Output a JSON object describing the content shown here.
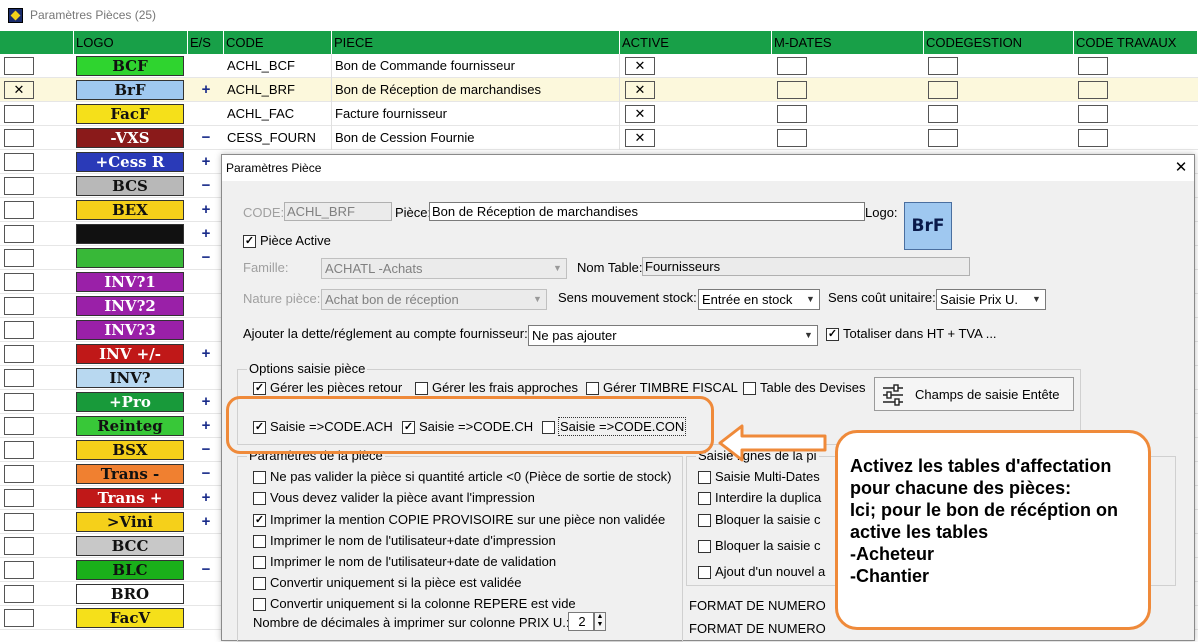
{
  "window": {
    "title": "Paramètres Pièces (25)"
  },
  "grid": {
    "headers": [
      "",
      "LOGO",
      "E/S",
      "CODE",
      "PIECE",
      "ACTIVE",
      "M-DATES",
      "CODEGESTION",
      "CODE TRAVAUX"
    ],
    "rows": [
      {
        "code": "ACHL_BCF",
        "piece": "Bon de Commande fournisseur",
        "active": "✕",
        "sel": "",
        "es": ""
      },
      {
        "code": "ACHL_BRF",
        "piece": "Bon de Réception de marchandises",
        "active": "✕",
        "sel": "✕",
        "es": "+"
      },
      {
        "code": "ACHL_FAC",
        "piece": "Facture fournisseur",
        "active": "✕",
        "sel": "",
        "es": ""
      },
      {
        "code": "CESS_FOURN",
        "piece": "Bon de Cession Fournie",
        "active": "✕",
        "sel": "",
        "es": "−"
      }
    ],
    "logos": [
      "BCF",
      "BrF",
      "FacF",
      "-VXS",
      "+Cess R",
      "BCS",
      "BEX",
      "",
      "",
      "INV?1",
      "INV?2",
      "INV?3",
      "INV +/-",
      "INV?",
      "+Pro",
      "Reinteg",
      "BSX",
      "Trans -",
      "Trans +",
      ">Vini",
      "BCC",
      "BLC",
      "BRO",
      "FacV"
    ],
    "logo_colors": [
      "#2fd42f",
      "#9fc8f0",
      "#f5e01a",
      "#8a1a1a",
      "#2a3ab8",
      "#b8b8b8",
      "#f5d01a",
      "#111111",
      "#38b838",
      "#9a20a8",
      "#9a20a8",
      "#9a20a8",
      "#c01818",
      "#b8d8f0",
      "#189a3a",
      "#38c838",
      "#f5d01a",
      "#f08030",
      "#c01818",
      "#f5d01a",
      "#c8c8c8",
      "#1ab01a",
      "#ffffff",
      "#f5e01a"
    ],
    "es_marks": [
      "",
      "+",
      "",
      "−",
      "+",
      "−",
      "+",
      "+",
      "−",
      "",
      "",
      "",
      "+",
      "",
      "+",
      "+",
      "−",
      "−",
      "+",
      "+",
      "",
      "−",
      "",
      ""
    ]
  },
  "dialog": {
    "title": "Paramètres Pièce",
    "code_label": "CODE:",
    "code_value": "ACHL_BRF",
    "piece_label": "Pièce:",
    "piece_value": "Bon de Réception de marchandises",
    "logo_label": "Logo:",
    "logo_text": "BrF",
    "piece_active_label": "Pièce Active",
    "famille_label": "Famille:",
    "famille_value": "ACHATL    -Achats",
    "nom_table_label": "Nom Table:",
    "nom_table_value": "Fournisseurs",
    "nature_label": "Nature pièce:",
    "nature_value": "Achat bon de réception",
    "sens_mvt_label": "Sens mouvement stock:",
    "sens_mvt_value": "Entrée en stock",
    "sens_cout_label": "Sens coût unitaire:",
    "sens_cout_value": "Saisie Prix U.",
    "ajouter_label": "Ajouter la dette/réglement au compte fournisseur:",
    "ajouter_value": "Ne pas ajouter",
    "totaliser_label": "Totaliser dans HT + TVA ...",
    "options_title": "Options saisie pièce",
    "opt_retour": "Gérer les pièces retour",
    "opt_frais": "Gérer les frais approches",
    "opt_timbre": "Gérer TIMBRE FISCAL",
    "opt_devises": "Table des Devises",
    "btn_champs": "Champs de saisie Entête",
    "opt_ach": "Saisie =>CODE.ACH",
    "opt_ch": "Saisie =>CODE.CH",
    "opt_con": "Saisie =>CODE.CON",
    "params_title": "Paramètres de la pièce",
    "params": [
      {
        "label": "Ne pas valider la pièce si quantité article <0 (Pièce de sortie de stock)",
        "checked": ""
      },
      {
        "label": "Vous devez valider la pièce avant l'impression",
        "checked": ""
      },
      {
        "label": "Imprimer la mention COPIE PROVISOIRE sur une pièce non validée",
        "checked": "✓"
      },
      {
        "label": "Imprimer le nom de l'utilisateur+date d'impression",
        "checked": ""
      },
      {
        "label": "Imprimer le nom de l'utilisateur+date de validation",
        "checked": ""
      },
      {
        "label": "Convertir uniquement si la pièce est validée",
        "checked": ""
      },
      {
        "label": "Convertir uniquement si la colonne REPERE est vide",
        "checked": ""
      }
    ],
    "decimales_label": "Nombre de décimales à imprimer sur colonne PRIX U.:",
    "decimales_value": "2",
    "saisie_lignes_title": "Saisie lignes de la pi",
    "right_opts": [
      "Saisie Multi-Dates",
      "Interdire la duplica",
      "Bloquer la saisie c",
      "Bloquer la saisie c",
      "Ajout d'un nouvel a"
    ],
    "format1": "FORMAT DE NUMERO",
    "format2": "FORMAT DE NUMERO"
  },
  "callout": {
    "lines": [
      "Activez les tables d'affectation",
      "pour chacune des pièces:",
      "Ici; pour le bon de récéption on",
      "active les tables",
      "-Acheteur",
      "-Chantier"
    ],
    "color": "#ef8a3a"
  }
}
